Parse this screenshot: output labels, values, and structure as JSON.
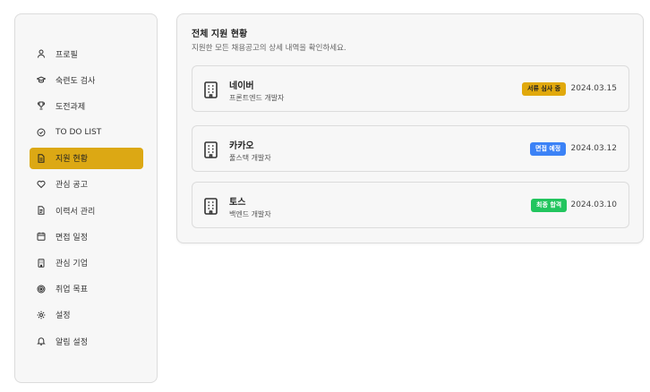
{
  "sidebar": {
    "items": [
      {
        "label": "프로필",
        "icon": "user-icon",
        "active": false
      },
      {
        "label": "숙련도 검사",
        "icon": "graduation-cap-icon",
        "active": false
      },
      {
        "label": "도전과제",
        "icon": "trophy-icon",
        "active": false
      },
      {
        "label": "TO DO LIST",
        "icon": "check-circle-icon",
        "active": false
      },
      {
        "label": "지원 현황",
        "icon": "document-icon",
        "active": true
      },
      {
        "label": "관심 공고",
        "icon": "heart-icon",
        "active": false
      },
      {
        "label": "이력서 관리",
        "icon": "file-text-icon",
        "active": false
      },
      {
        "label": "면접 일정",
        "icon": "calendar-icon",
        "active": false
      },
      {
        "label": "관심 기업",
        "icon": "building-icon",
        "active": false
      },
      {
        "label": "취업 목표",
        "icon": "target-icon",
        "active": false
      },
      {
        "label": "설정",
        "icon": "gear-icon",
        "active": false
      },
      {
        "label": "알림 설정",
        "icon": "bell-icon",
        "active": false
      }
    ],
    "active_color": "#dca814"
  },
  "main": {
    "title": "전체 지원 현황",
    "subtitle": "지원한 모든 채용공고의 상세 내역을 확인하세요.",
    "applications": [
      {
        "company": "네이버",
        "position": "프론트엔드 개발자",
        "status": "서류 심사 중",
        "status_bg": "#e1a90c",
        "status_fg": "#222222",
        "date": "2024.03.15",
        "icon": "building-icon"
      },
      {
        "company": "카카오",
        "position": "풀스택 개발자",
        "status": "면접 예정",
        "status_bg": "#3b82f6",
        "status_fg": "#ffffff",
        "date": "2024.03.12",
        "icon": "building-icon"
      },
      {
        "company": "토스",
        "position": "백엔드 개발자",
        "status": "최종 합격",
        "status_bg": "#22c55e",
        "status_fg": "#ffffff",
        "date": "2024.03.10",
        "icon": "building-icon"
      }
    ]
  }
}
